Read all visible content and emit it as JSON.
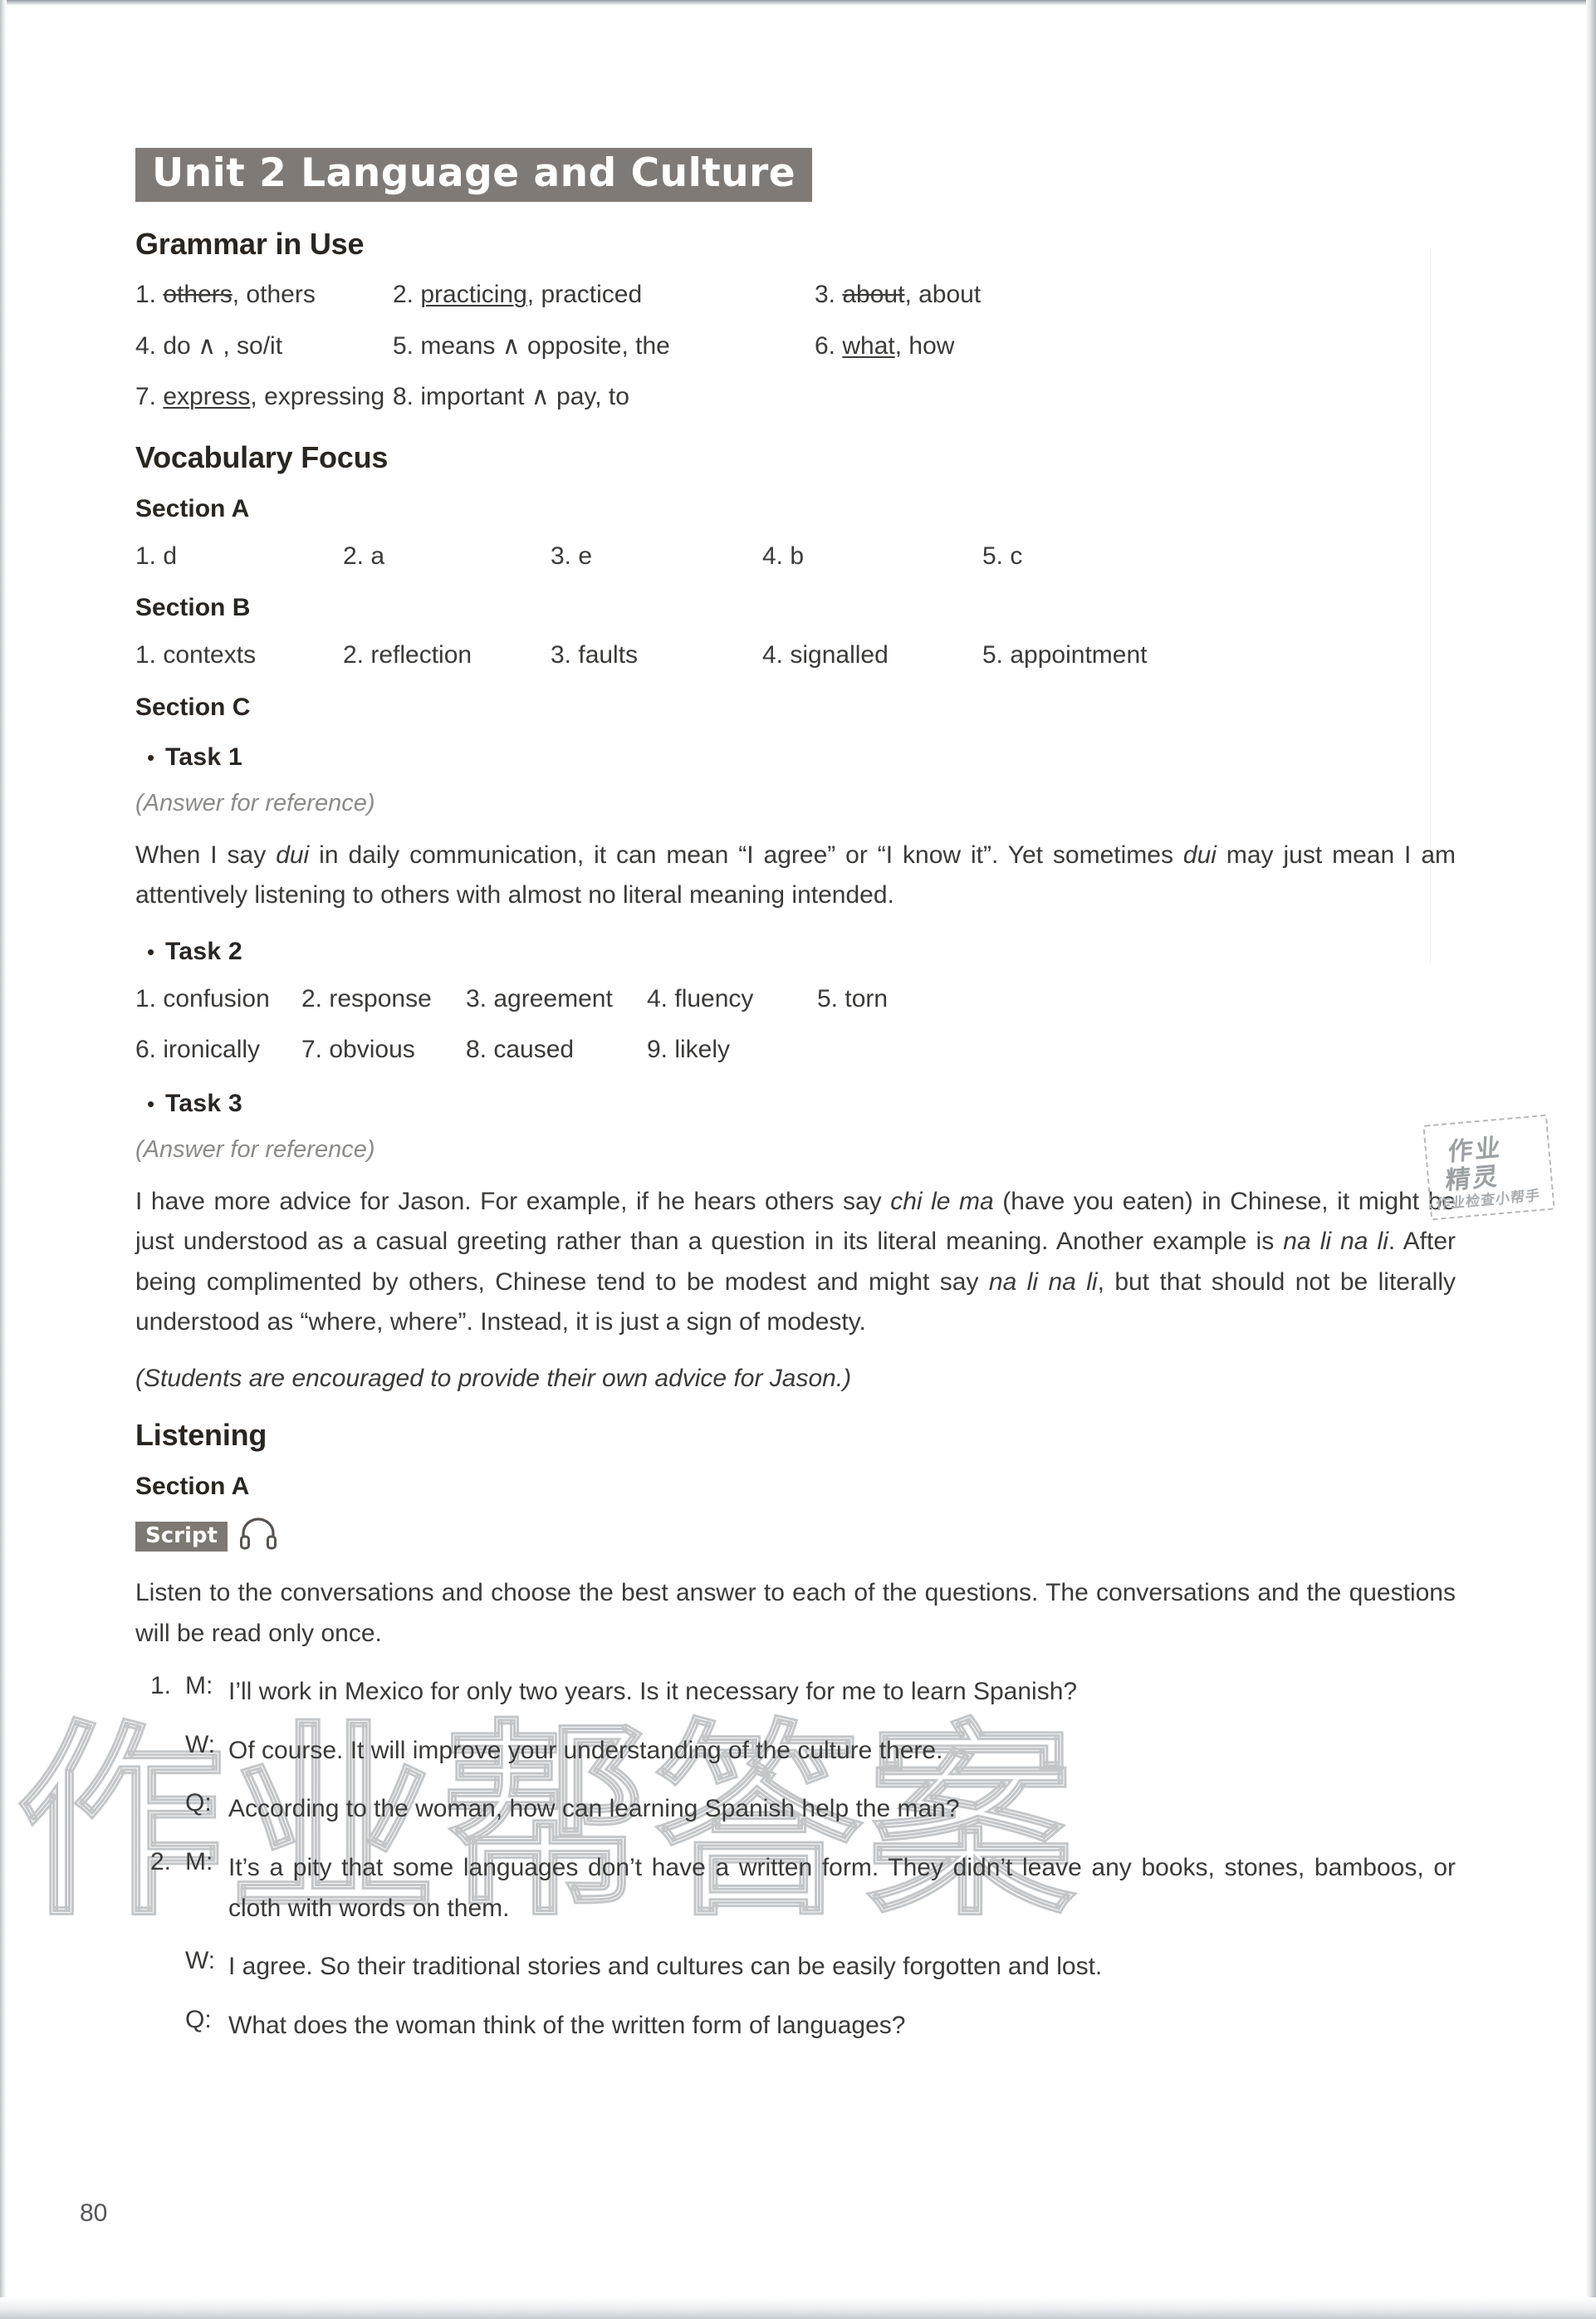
{
  "page": {
    "number": "80",
    "unit_title": "Unit 2 Language and Culture"
  },
  "grammar": {
    "heading": "Grammar in Use",
    "rows": [
      [
        {
          "num": "1.",
          "struck": "others",
          "rest": ", others"
        },
        {
          "num": "2.",
          "underlined": "practicing",
          "rest": ", practiced"
        },
        {
          "num": "3.",
          "struck": "about",
          "rest": ", about"
        }
      ],
      [
        {
          "num": "4.",
          "plain": "do ∧ , so/it"
        },
        {
          "num": "5.",
          "plain": "means ∧ opposite, the"
        },
        {
          "num": "6.",
          "underlined": "what",
          "rest": ", how"
        }
      ],
      [
        {
          "num": "7.",
          "underlined": "express",
          "rest": ", expressing"
        },
        {
          "num": "8.",
          "plain": "important ∧ pay, to"
        },
        {
          "num": "",
          "plain": ""
        }
      ]
    ]
  },
  "vocabulary": {
    "heading": "Vocabulary Focus",
    "section_a_label": "Section A",
    "section_a": [
      "1. d",
      "2. a",
      "3. e",
      "4. b",
      "5. c"
    ],
    "section_b_label": "Section B",
    "section_b": [
      "1. contexts",
      "2. reflection",
      "3. faults",
      "4. signalled",
      "5. appointment"
    ],
    "section_c_label": "Section C",
    "bullet": "•",
    "task1_label": "Task 1",
    "task1_ref": "(Answer for reference)",
    "task1_answer_p1": "When I say ",
    "task1_answer_i1": "dui",
    "task1_answer_p2": " in daily communication, it can mean “I agree” or “I know it”. Yet sometimes ",
    "task1_answer_i2": "dui",
    "task1_answer_p3": " may just mean I am attentively listening to others with almost no literal meaning intended.",
    "task2_label": "Task 2",
    "task2_row1": [
      "1. confusion",
      "2. response",
      "3. agreement",
      "4. fluency",
      "5. torn"
    ],
    "task2_row2": [
      "6. ironically",
      "7. obvious",
      "8. caused",
      "9. likely",
      ""
    ],
    "task3_label": "Task 3",
    "task3_ref": "(Answer for reference)",
    "task3_p1": "I have more advice for Jason. For example, if he hears others say ",
    "task3_i1": "chi le ma",
    "task3_p2": " (have you eaten) in Chinese, it might be just understood as a casual greeting rather than a question in its literal meaning. Another example is ",
    "task3_i2": "na li na li",
    "task3_p3": ". After being complimented by others, Chinese tend to be modest and might say ",
    "task3_i3": "na li na li",
    "task3_p4": ", but that should not be literally understood as “where, where”. Instead, it is just a sign of modesty.",
    "task3_note": "(Students are encouraged to provide their own advice for Jason.)"
  },
  "listening": {
    "heading": "Listening",
    "section_a_label": "Section A",
    "script_badge": "Script",
    "instructions": "Listen to the conversations and choose the best answer to each of the questions. The conversations and the questions will be read only once.",
    "dialogues": [
      {
        "num": "1.",
        "lines": [
          {
            "speaker": "M:",
            "text": "I’ll work in Mexico for only two years. Is it necessary for me to learn Spanish?"
          },
          {
            "speaker": "W:",
            "text": "Of course. It will improve your understanding of the culture there."
          },
          {
            "speaker": "Q:",
            "text": "According to the woman, how can learning Spanish help the man?"
          }
        ]
      },
      {
        "num": "2.",
        "lines": [
          {
            "speaker": "M:",
            "text": "It’s a pity that some languages don’t have a written form. They didn’t leave any books, stones, bamboos, or cloth with words on them."
          },
          {
            "speaker": "W:",
            "text": "I agree. So their traditional stories and cultures can be easily forgotten and lost."
          },
          {
            "speaker": "Q:",
            "text": "What does the woman think of the written form of languages?"
          }
        ]
      }
    ]
  },
  "watermarks": {
    "big_text": "作业帮答案",
    "stamp_line1": "作业",
    "stamp_line2": "精灵",
    "stamp_line3": "作业检查小帮手"
  },
  "colors": {
    "banner_bg": "#807a76",
    "badge_bg": "#7e7873",
    "heading": "#2b2520",
    "body_text": "#3a3a38",
    "ref_note": "#8b8b88",
    "watermark": "#b9bdc0"
  }
}
